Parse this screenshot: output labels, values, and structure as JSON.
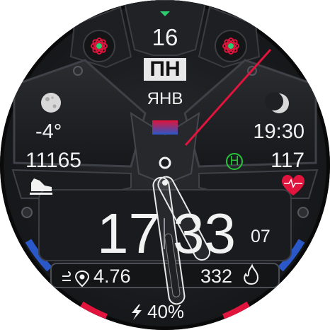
{
  "date": {
    "day": "16",
    "weekday": "ПН",
    "month": "ЯНВ"
  },
  "weather": {
    "temperature": "-4°",
    "icon": "moon-full-icon"
  },
  "steps": {
    "value": "11165",
    "icon": "shoe-icon"
  },
  "sunset": {
    "time": "19:30",
    "icon": "moon-eclipse-icon"
  },
  "heart": {
    "value": "117",
    "icon": "heart-rate-icon",
    "zone_badge": "H"
  },
  "time": {
    "hours": "17",
    "minutes": "33",
    "seconds": "07"
  },
  "distance": {
    "value": "4.76",
    "icon": "route-pin-icon"
  },
  "calories": {
    "value": "332",
    "icon": "flame-icon"
  },
  "battery": {
    "value": "40%",
    "icon": "lightning-icon"
  },
  "colors": {
    "accent_red": "#e0143c",
    "accent_blue": "#2a58c8",
    "badge_green": "#27c43a",
    "indicator_green": "#2ecc71"
  }
}
